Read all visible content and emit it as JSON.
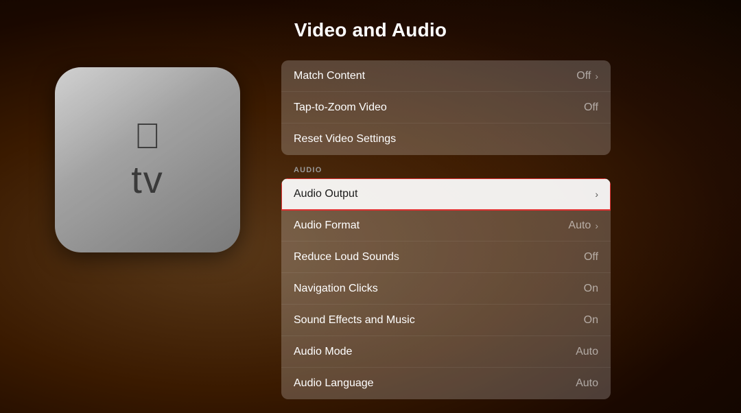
{
  "page": {
    "title": "Video and Audio"
  },
  "video_section": {
    "rows": [
      {
        "id": "match-content",
        "label": "Match Content",
        "value": "Off",
        "has_chevron": true,
        "highlighted": false
      },
      {
        "id": "tap-to-zoom",
        "label": "Tap-to-Zoom Video",
        "value": "Off",
        "has_chevron": false,
        "highlighted": false
      },
      {
        "id": "reset-video",
        "label": "Reset Video Settings",
        "value": "",
        "has_chevron": false,
        "highlighted": false
      }
    ]
  },
  "audio_section": {
    "label": "AUDIO",
    "rows": [
      {
        "id": "audio-output",
        "label": "Audio Output",
        "value": "",
        "has_chevron": true,
        "highlighted": true
      },
      {
        "id": "audio-format",
        "label": "Audio Format",
        "value": "Auto",
        "has_chevron": true,
        "highlighted": false
      },
      {
        "id": "reduce-loud",
        "label": "Reduce Loud Sounds",
        "value": "Off",
        "has_chevron": false,
        "highlighted": false
      },
      {
        "id": "nav-clicks",
        "label": "Navigation Clicks",
        "value": "On",
        "has_chevron": false,
        "highlighted": false
      },
      {
        "id": "sound-effects",
        "label": "Sound Effects and Music",
        "value": "On",
        "has_chevron": false,
        "highlighted": false
      },
      {
        "id": "audio-mode",
        "label": "Audio Mode",
        "value": "Auto",
        "has_chevron": false,
        "highlighted": false
      },
      {
        "id": "audio-language",
        "label": "Audio Language",
        "value": "Auto",
        "has_chevron": false,
        "highlighted": false
      }
    ]
  },
  "icons": {
    "chevron": "›",
    "apple_logo": ""
  }
}
